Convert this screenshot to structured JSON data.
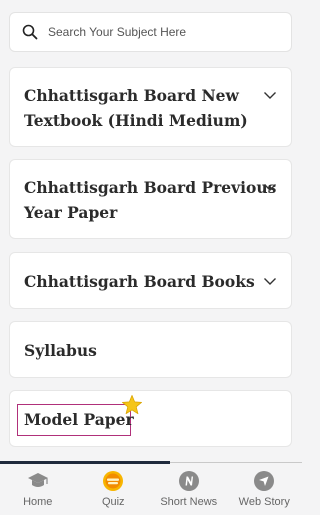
{
  "search": {
    "placeholder": "Search Your Subject Here"
  },
  "cards": [
    {
      "lines": [
        "Chhattisgarh Board New",
        "Textbook (Hindi Medium)"
      ],
      "expandable": true
    },
    {
      "lines": [
        "Chhattisgarh Board Previous",
        "Year Paper"
      ],
      "expandable": true
    },
    {
      "lines": [
        "Chhattisgarh Board Books"
      ],
      "expandable": true
    },
    {
      "lines": [
        "Syllabus"
      ],
      "expandable": false
    },
    {
      "lines": [
        "Model Paper"
      ],
      "expandable": false,
      "highlighted": true,
      "icon": "star-icon"
    }
  ],
  "bottom_nav": [
    {
      "label": "Home",
      "icon": "graduation-cap-icon"
    },
    {
      "label": "Quiz",
      "icon": "quiz-time-icon"
    },
    {
      "label": "Short News",
      "icon": "news-n-icon"
    },
    {
      "label": "Web Story",
      "icon": "compass-arrow-icon"
    }
  ],
  "colors": {
    "highlight_border": "#b0307a",
    "star": "#f5c518",
    "progress": "#1f2a3c"
  }
}
